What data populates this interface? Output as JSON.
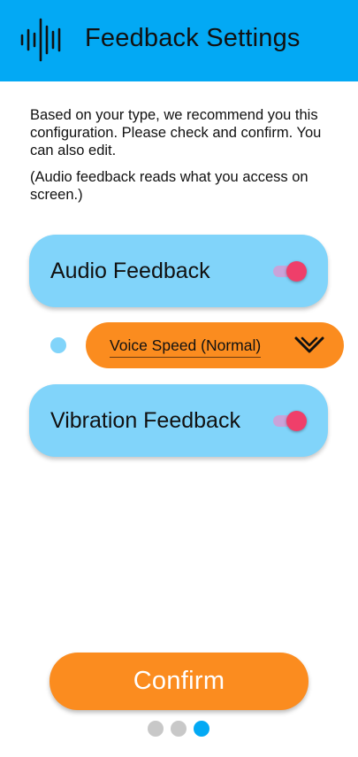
{
  "header": {
    "title": "Feedback Settings",
    "logo_icon": "waveform-icon",
    "background": "#03a9f4"
  },
  "intro": {
    "paragraph1": "Based on your type, we recommend you this configuration. Please check and confirm. You can also edit.",
    "paragraph2": "(Audio feedback reads what you access on screen.)"
  },
  "settings": {
    "audio": {
      "label": "Audio Feedback",
      "enabled": true
    },
    "voice_speed": {
      "selected": "Voice Speed (Normal)",
      "icon": "chevron-down-icon"
    },
    "vibration": {
      "label": "Vibration Feedback",
      "enabled": true
    }
  },
  "confirm_label": "Confirm",
  "pager": {
    "count": 3,
    "current": 3
  },
  "colors": {
    "card": "#81d4fa",
    "accent_orange": "#fb8c1f",
    "toggle_on": "#ef3f6a",
    "pager_active": "#03a9f4",
    "pager_inactive": "#c8c8c8"
  }
}
